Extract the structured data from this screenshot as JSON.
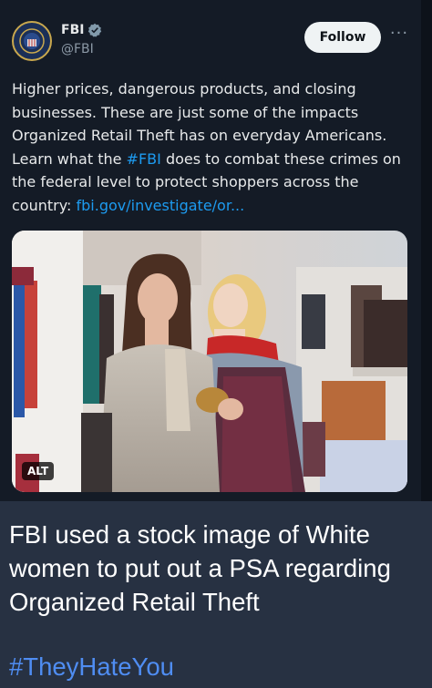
{
  "tweet": {
    "author_name": "FBI",
    "author_handle": "@FBI",
    "follow_label": "Follow",
    "more_label": "···",
    "text_segments": [
      "Higher prices, dangerous products, and closing businesses. These are just some of the impacts Organized Retail Theft has on everyday Americans. Learn what the ",
      "#FBI",
      " does to combat these crimes on the federal level to protect shoppers across the country: ",
      "fbi.gov/investigate/or..."
    ],
    "media_alt_badge": "ALT"
  },
  "meme": {
    "caption": "FBI used a stock image of White women to put out a PSA regarding Organized Retail Theft",
    "hashtag": "#TheyHateYou"
  },
  "colors": {
    "card_bg": "#141b26",
    "page_bg": "#273142",
    "link": "#1d9bf0",
    "hashtag": "#4f8df2",
    "verified": "#829aab"
  },
  "icons": {
    "verified": "verified-badge-icon",
    "more": "more-options-icon",
    "avatar": "fbi-seal-icon"
  }
}
